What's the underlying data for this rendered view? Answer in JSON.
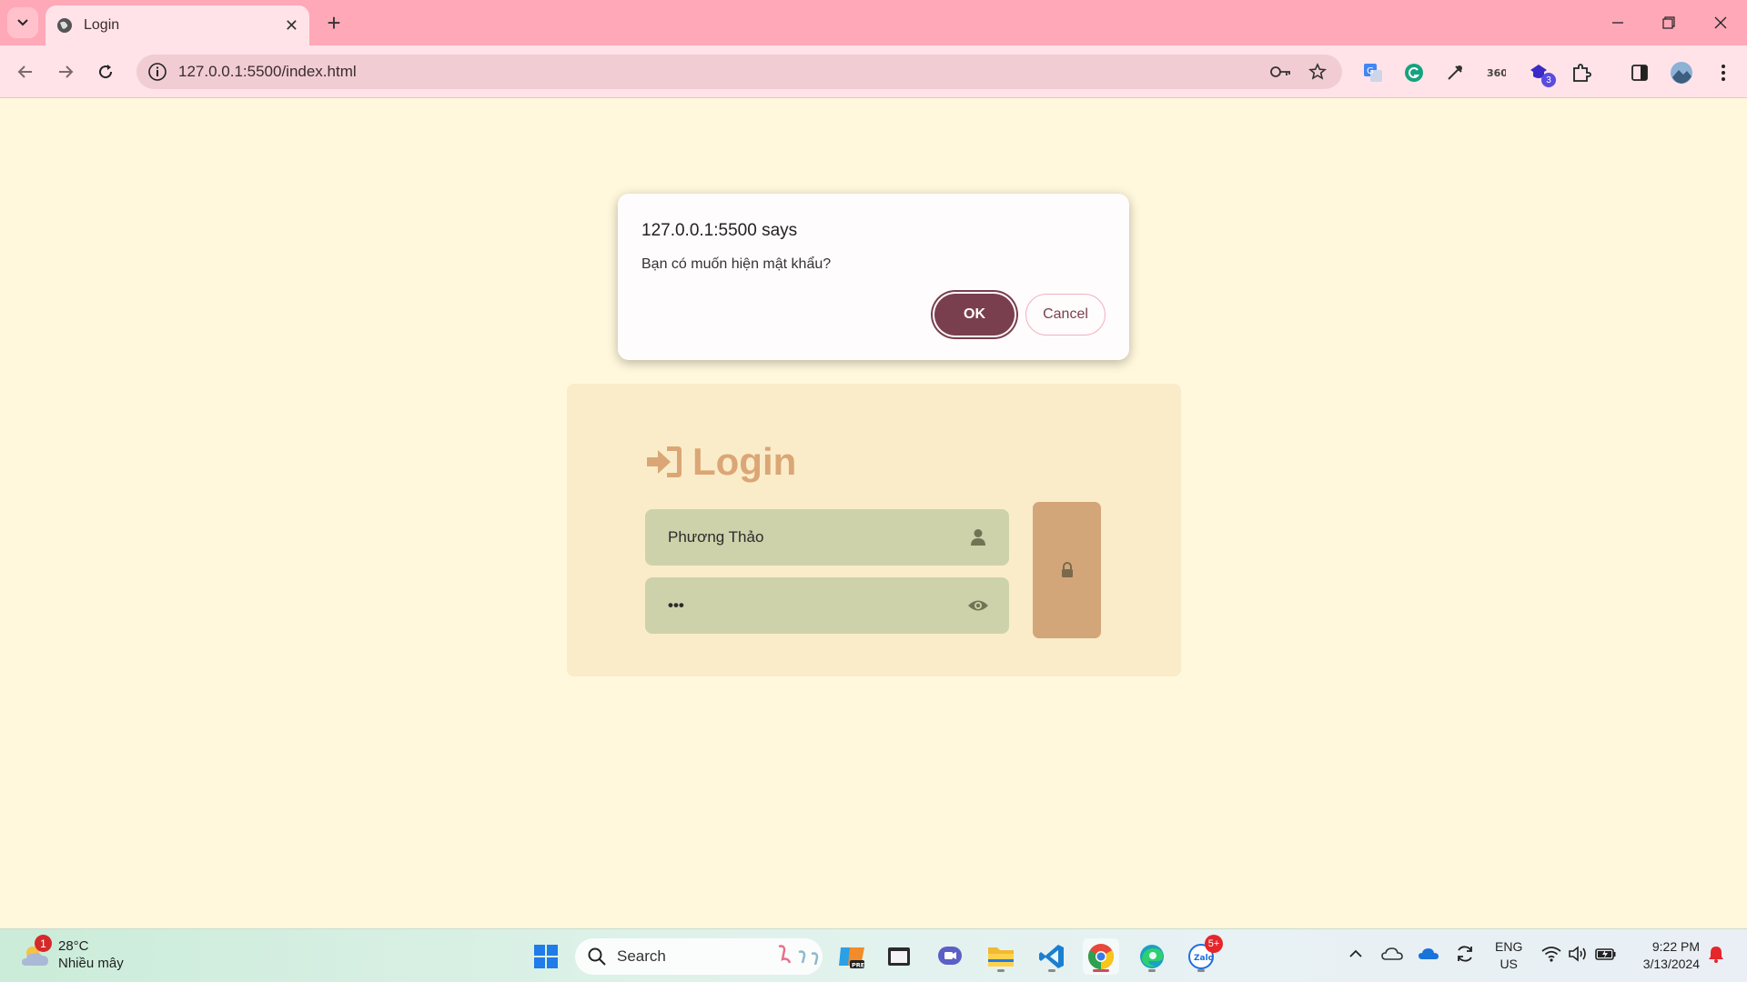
{
  "browser": {
    "tab_title": "Login",
    "url": "127.0.0.1:5500/index.html",
    "extensions_badge": "3"
  },
  "dialog": {
    "title": "127.0.0.1:5500 says",
    "message": "Bạn có muốn hiện mật khẩu?",
    "ok_label": "OK",
    "cancel_label": "Cancel"
  },
  "login": {
    "title": "Login",
    "username_value": "Phương Thảo",
    "password_value": "•••"
  },
  "taskbar": {
    "weather_temp": "28°C",
    "weather_condition": "Nhiều mây",
    "weather_badge": "1",
    "search_placeholder": "Search",
    "zalo_badge": "5+",
    "lang_top": "ENG",
    "lang_bottom": "US",
    "time": "9:22 PM",
    "date": "3/13/2024"
  },
  "colors": {
    "tabbar": "#ffa8b8",
    "toolbar": "#ffe3e8",
    "page_bg": "#fff8dc",
    "card_bg": "#faecc9",
    "accent": "#dba676",
    "field_bg": "#cdd2ab",
    "lock_btn": "#d3a679",
    "dialog_ok": "#7a3f4e"
  }
}
